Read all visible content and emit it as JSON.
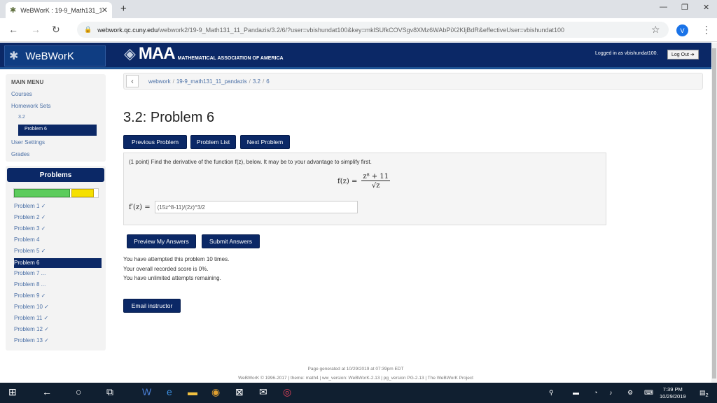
{
  "browser": {
    "tab_title": "WeBWorK : 19-9_Math131_11_",
    "url_host": "webwork.qc.cuny.edu",
    "url_path": "/webwork2/19-9_Math131_11_Pandazis/3.2/6/?user=vbishundat100&key=mklSUfkCOVSgv8XMz6WAbPiX2KljBdR&effectiveUser=vbishundat100",
    "avatar_letter": "V"
  },
  "header": {
    "site_name": "WeBWorK",
    "maa_big": "MAA",
    "maa_small": "MATHEMATICAL ASSOCIATION OF AMERICA",
    "logged_in_text": "Logged in as vbishundat100.",
    "logout_label": "Log Out"
  },
  "sidebar": {
    "menu_title": "MAIN MENU",
    "courses": "Courses",
    "homework_sets": "Homework Sets",
    "set_item": "3.2",
    "problem_item": "Problem 6",
    "user_settings": "User Settings",
    "grades": "Grades"
  },
  "problems_panel": {
    "title": "Problems",
    "progress_correct_fraction": 0.68,
    "progress_attempted_fraction": 0.28,
    "items": [
      "Problem 1 ✓",
      "Problem 2 ✓",
      "Problem 3 ✓",
      "Problem 4",
      "Problem 5 ✓",
      "Problem 6",
      "Problem 7 ...",
      "Problem 8 ...",
      "Problem 9 ✓",
      "Problem 10 ✓",
      "Problem 11 ✓",
      "Problem 12 ✓",
      "Problem 13 ✓"
    ]
  },
  "breadcrumb": {
    "course": "webwork",
    "set": "19-9_math131_11_pandazis",
    "section": "3.2",
    "problem": "6"
  },
  "main": {
    "title": "3.2: Problem 6",
    "prev_label": "Previous Problem",
    "list_label": "Problem List",
    "next_label": "Next Problem",
    "statement": "(1 point) Find the derivative of the function f(z), below. It may be to your advantage to simplify first.",
    "formula_lhs": "f(z) =",
    "formula_num": "z⁸ + 11",
    "formula_den": "√z",
    "answer_label": "f′(z) =",
    "answer_value": "(15z^8-11)/(2z)^3/2",
    "preview_label": "Preview My Answers",
    "submit_label": "Submit Answers",
    "attempts_line1": "You have attempted this problem 10 times.",
    "attempts_line2": "Your overall recorded score is 0%.",
    "attempts_line3": "You have unlimited attempts remaining.",
    "email_label": "Email instructor"
  },
  "footer": {
    "line1": "Page generated at 10/29/2019 at 07:39pm EDT",
    "line2": "WeBWorK © 1996-2017 | theme: math4 | ww_version: WeBWorK-2.13 | pg_version PG-2.13 | The WeBWorK Project"
  },
  "taskbar": {
    "time": "7:39 PM",
    "date": "10/29/2019",
    "notifications": "2"
  }
}
